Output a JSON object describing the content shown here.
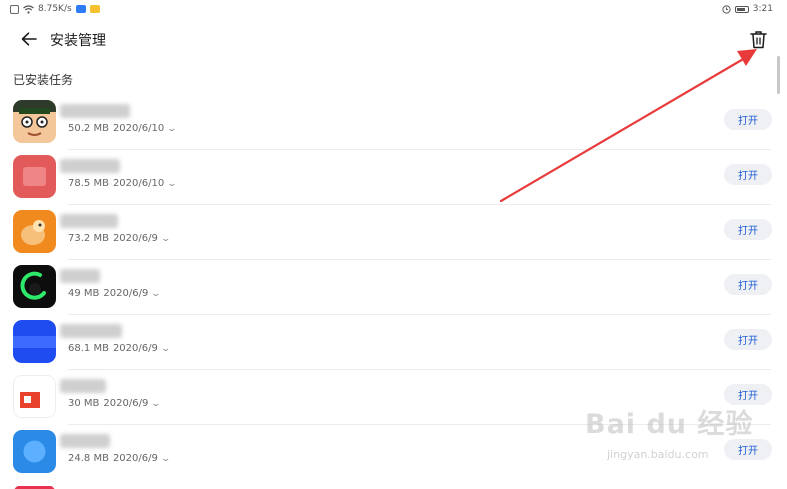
{
  "status_bar": {
    "network_speed": "8.75K/s",
    "time": "3:21"
  },
  "header": {
    "title": "安装管理"
  },
  "section": {
    "title": "已安装任务"
  },
  "apps": [
    {
      "size": "50.2 MB",
      "date": "2020/6/10",
      "action": "打开"
    },
    {
      "size": "78.5 MB",
      "date": "2020/6/10",
      "action": "打开"
    },
    {
      "size": "73.2 MB",
      "date": "2020/6/9",
      "action": "打开"
    },
    {
      "size": "49 MB",
      "date": "2020/6/9",
      "action": "打开"
    },
    {
      "size": "68.1 MB",
      "date": "2020/6/9",
      "action": "打开"
    },
    {
      "size": "30 MB",
      "date": "2020/6/9",
      "action": "打开"
    },
    {
      "size": "24.8 MB",
      "date": "2020/6/9",
      "action": "打开"
    }
  ],
  "watermark": {
    "logo": "Bai du 经验",
    "url": "jingyan.baidu.com"
  },
  "colors": {
    "accent": "#1e5bd6",
    "annotation_arrow": "#e83a3a"
  }
}
